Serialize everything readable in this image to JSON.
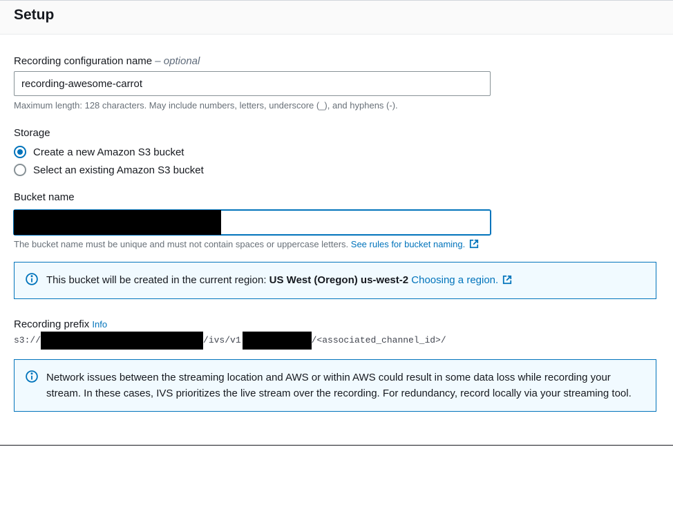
{
  "header": {
    "title": "Setup"
  },
  "configName": {
    "label": "Recording configuration name",
    "optional_suffix": " – optional",
    "value": "recording-awesome-carrot",
    "hint": "Maximum length: 128 characters. May include numbers, letters, underscore (_), and hyphens (-)."
  },
  "storage": {
    "label": "Storage",
    "options": [
      "Create a new Amazon S3 bucket",
      "Select an existing Amazon S3 bucket"
    ],
    "selected": 0
  },
  "bucket": {
    "label": "Bucket name",
    "hint_text": "The bucket name must be unique and must not contain spaces or uppercase letters. ",
    "hint_link": "See rules for bucket naming."
  },
  "regionInfo": {
    "pre": "This bucket will be created in the current region: ",
    "region_bold": "US West (Oregon) us-west-2",
    "link": " Choosing a region."
  },
  "prefix": {
    "label": "Recording prefix",
    "info_link": "Info",
    "protocol": "s3://",
    "mid1": "/ivs/v1",
    "tail": "/<associated_channel_id>/"
  },
  "networkInfo": {
    "text": "Network issues between the streaming location and AWS or within AWS could result in some data loss while recording your stream. In these cases, IVS prioritizes the live stream over the recording. For redundancy, record locally via your streaming tool."
  }
}
